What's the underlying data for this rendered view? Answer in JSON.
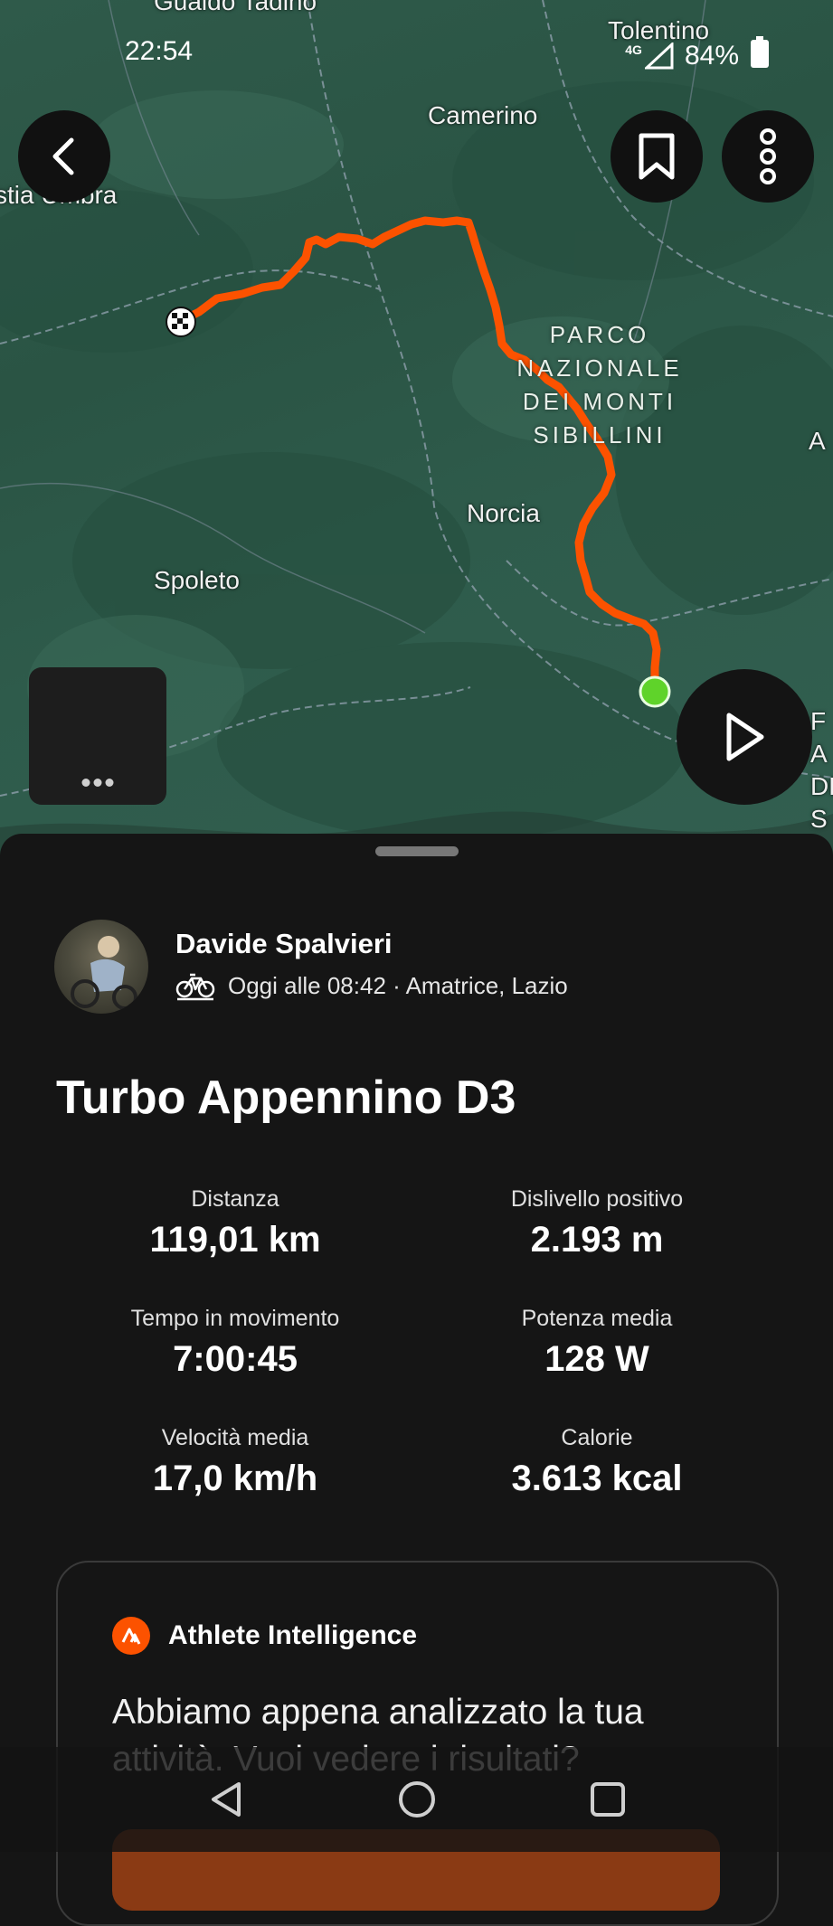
{
  "status_bar": {
    "time": "22:54",
    "network": "4G",
    "battery": "84%"
  },
  "map": {
    "labels": {
      "gualdo": "Gualdo Tadino",
      "tolentino": "Tolentino",
      "camerino": "Camerino",
      "nocera": "stia Umbra",
      "park": "PARCO NAZIONALE DEI MONTI SIBILLINI",
      "norcia": "Norcia",
      "spoleto": "Spoleto",
      "edge_a": "A",
      "edge_right": "F A DE S"
    },
    "route_color": "#fc5200",
    "end_marker_color": "#5fd32a"
  },
  "activity": {
    "athlete_name": "Davide Spalvieri",
    "meta": "Oggi alle 08:42 · Amatrice, Lazio",
    "title": "Turbo Appennino D3",
    "stats": {
      "distance_label": "Distanza",
      "distance_value": "119,01 km",
      "elevation_label": "Dislivello positivo",
      "elevation_value": "2.193 m",
      "moving_time_label": "Tempo in movimento",
      "moving_time_value": "7:00:45",
      "power_label": "Potenza media",
      "power_value": "128 W",
      "speed_label": "Velocità media",
      "speed_value": "17,0 km/h",
      "calories_label": "Calorie",
      "calories_value": "3.613 kcal"
    }
  },
  "athlete_intelligence": {
    "title": "Athlete Intelligence",
    "message": "Abbiamo appena analizzato la tua attività. Vuoi vedere i risultati?"
  },
  "icons": {
    "back": "chevron-left-icon",
    "bookmark": "bookmark-icon",
    "more": "more-vertical-icon",
    "play": "play-icon",
    "bike": "bike-icon"
  }
}
